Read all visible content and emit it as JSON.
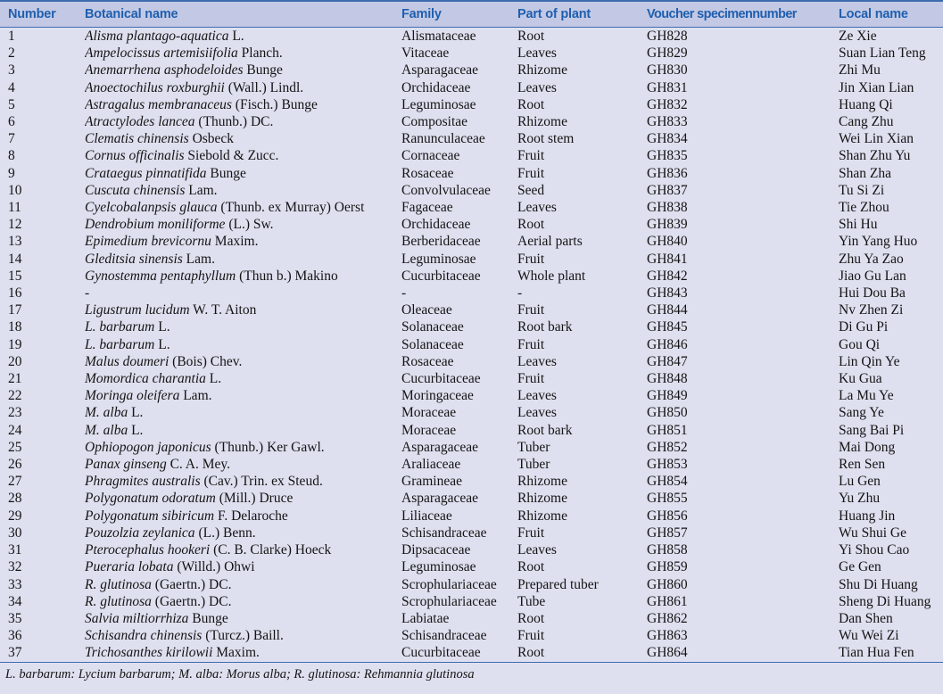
{
  "table": {
    "columns": [
      {
        "key": "number",
        "label": "Number"
      },
      {
        "key": "botanical",
        "label": "Botanical name"
      },
      {
        "key": "family",
        "label": "Family"
      },
      {
        "key": "part",
        "label": "Part of plant"
      },
      {
        "key": "voucher",
        "label": "Voucher specimennumber"
      },
      {
        "key": "local",
        "label": "Local name"
      }
    ],
    "rows": [
      {
        "number": "1",
        "botanical_italic": "Alisma plantago-aquatica",
        "botanical_rest": " L.",
        "family": "Alismataceae",
        "part": "Root",
        "voucher": "GH828",
        "local": "Ze Xie"
      },
      {
        "number": "2",
        "botanical_italic": "Ampelocissus artemisiifolia",
        "botanical_rest": " Planch.",
        "family": "Vitaceae",
        "part": "Leaves",
        "voucher": "GH829",
        "local": "Suan Lian Teng"
      },
      {
        "number": "3",
        "botanical_italic": "Anemarrhena asphodeloides",
        "botanical_rest": " Bunge",
        "family": "Asparagaceae",
        "part": "Rhizome",
        "voucher": "GH830",
        "local": "Zhi Mu"
      },
      {
        "number": "4",
        "botanical_italic": "Anoectochilus roxburghii",
        "botanical_rest": " (Wall.) Lindl.",
        "family": "Orchidaceae",
        "part": "Leaves",
        "voucher": "GH831",
        "local": "Jin Xian Lian"
      },
      {
        "number": "5",
        "botanical_italic": "Astragalus membranaceus",
        "botanical_rest": " (Fisch.) Bunge",
        "family": "Leguminosae",
        "part": "Root",
        "voucher": "GH832",
        "local": "Huang Qi"
      },
      {
        "number": "6",
        "botanical_italic": "Atractylodes lancea",
        "botanical_rest": " (Thunb.) DC.",
        "family": "Compositae",
        "part": "Rhizome",
        "voucher": "GH833",
        "local": "Cang Zhu"
      },
      {
        "number": "7",
        "botanical_italic": "Clematis chinensis",
        "botanical_rest": " Osbeck",
        "family": "Ranunculaceae",
        "part": "Root stem",
        "voucher": "GH834",
        "local": "Wei Lin Xian"
      },
      {
        "number": "8",
        "botanical_italic": "Cornus officinalis",
        "botanical_rest": " Siebold & Zucc.",
        "family": "Cornaceae",
        "part": "Fruit",
        "voucher": "GH835",
        "local": "Shan Zhu Yu"
      },
      {
        "number": "9",
        "botanical_italic": "Crataegus pinnatifida",
        "botanical_rest": " Bunge",
        "family": "Rosaceae",
        "part": "Fruit",
        "voucher": "GH836",
        "local": "Shan Zha"
      },
      {
        "number": "10",
        "botanical_italic": "Cuscuta chinensis",
        "botanical_rest": " Lam.",
        "family": "Convolvulaceae",
        "part": "Seed",
        "voucher": "GH837",
        "local": "Tu Si Zi"
      },
      {
        "number": "11",
        "botanical_italic": "Cyelcobalanpsis glauca",
        "botanical_rest": " (Thunb. ex Murray) Oerst",
        "family": "Fagaceae",
        "part": "Leaves",
        "voucher": "GH838",
        "local": "Tie Zhou"
      },
      {
        "number": "12",
        "botanical_italic": "Dendrobium moniliforme",
        "botanical_rest": " (L.) Sw.",
        "family": "Orchidaceae",
        "part": "Root",
        "voucher": "GH839",
        "local": "Shi Hu"
      },
      {
        "number": "13",
        "botanical_italic": "Epimedium brevicornu",
        "botanical_rest": " Maxim.",
        "family": "Berberidaceae",
        "part": "Aerial parts",
        "voucher": "GH840",
        "local": "Yin Yang Huo"
      },
      {
        "number": "14",
        "botanical_italic": "Gleditsia sinensis",
        "botanical_rest": " Lam.",
        "family": "Leguminosae",
        "part": "Fruit",
        "voucher": "GH841",
        "local": "Zhu Ya Zao"
      },
      {
        "number": "15",
        "botanical_italic": "Gynostemma pentaphyllum",
        "botanical_rest": " (Thun b.) Makino",
        "family": "Cucurbitaceae",
        "part": "Whole plant",
        "voucher": "GH842",
        "local": "Jiao Gu Lan"
      },
      {
        "number": "16",
        "botanical_italic": "",
        "botanical_rest": "-",
        "family": "-",
        "part": "-",
        "voucher": "GH843",
        "local": "Hui Dou Ba"
      },
      {
        "number": "17",
        "botanical_italic": "Ligustrum lucidum",
        "botanical_rest": " W. T. Aiton",
        "family": "Oleaceae",
        "part": "Fruit",
        "voucher": "GH844",
        "local": "Nv Zhen Zi"
      },
      {
        "number": "18",
        "botanical_italic": "L. barbarum",
        "botanical_rest": " L.",
        "family": "Solanaceae",
        "part": "Root bark",
        "voucher": "GH845",
        "local": "Di Gu Pi"
      },
      {
        "number": "19",
        "botanical_italic": "L. barbarum",
        "botanical_rest": " L.",
        "family": "Solanaceae",
        "part": "Fruit",
        "voucher": "GH846",
        "local": "Gou Qi"
      },
      {
        "number": "20",
        "botanical_italic": "Malus doumeri",
        "botanical_rest": " (Bois) Chev.",
        "family": "Rosaceae",
        "part": "Leaves",
        "voucher": "GH847",
        "local": "Lin Qin Ye"
      },
      {
        "number": "21",
        "botanical_italic": "Momordica charantia",
        "botanical_rest": " L.",
        "family": "Cucurbitaceae",
        "part": "Fruit",
        "voucher": "GH848",
        "local": "Ku Gua"
      },
      {
        "number": "22",
        "botanical_italic": "Moringa oleifera",
        "botanical_rest": " Lam.",
        "family": "Moringaceae",
        "part": "Leaves",
        "voucher": "GH849",
        "local": "La Mu Ye"
      },
      {
        "number": "23",
        "botanical_italic": "M. alba",
        "botanical_rest": " L.",
        "family": "Moraceae",
        "part": "Leaves",
        "voucher": "GH850",
        "local": "Sang Ye"
      },
      {
        "number": "24",
        "botanical_italic": "M. alba",
        "botanical_rest": " L.",
        "family": "Moraceae",
        "part": "Root bark",
        "voucher": "GH851",
        "local": "Sang Bai Pi"
      },
      {
        "number": "25",
        "botanical_italic": "Ophiopogon japonicus",
        "botanical_rest": " (Thunb.) Ker Gawl.",
        "family": "Asparagaceae",
        "part": "Tuber",
        "voucher": "GH852",
        "local": "Mai Dong"
      },
      {
        "number": "26",
        "botanical_italic": "Panax ginseng",
        "botanical_rest": " C. A. Mey.",
        "family": "Araliaceae",
        "part": "Tuber",
        "voucher": "GH853",
        "local": "Ren Sen"
      },
      {
        "number": "27",
        "botanical_italic": "Phragmites australis",
        "botanical_rest": " (Cav.) Trin. ex Steud.",
        "family": "Gramineae",
        "part": "Rhizome",
        "voucher": "GH854",
        "local": "Lu Gen"
      },
      {
        "number": "28",
        "botanical_italic": "Polygonatum odoratum",
        "botanical_rest": " (Mill.) Druce",
        "family": "Asparagaceae",
        "part": "Rhizome",
        "voucher": "GH855",
        "local": "Yu Zhu"
      },
      {
        "number": "29",
        "botanical_italic": "Polygonatum sibiricum",
        "botanical_rest": " F. Delaroche",
        "family": "Liliaceae",
        "part": "Rhizome",
        "voucher": "GH856",
        "local": "Huang Jin"
      },
      {
        "number": "30",
        "botanical_italic": "Pouzolzia zeylanica",
        "botanical_rest": " (L.) Benn.",
        "family": "Schisandraceae",
        "part": "Fruit",
        "voucher": "GH857",
        "local": "Wu Shui Ge"
      },
      {
        "number": "31",
        "botanical_italic": "Pterocephalus hookeri",
        "botanical_rest": " (C. B. Clarke) Hoeck",
        "family": "Dipsacaceae",
        "part": "Leaves",
        "voucher": "GH858",
        "local": "Yi Shou Cao"
      },
      {
        "number": "32",
        "botanical_italic": "Pueraria lobata",
        "botanical_rest": " (Willd.) Ohwi",
        "family": "Leguminosae",
        "part": "Root",
        "voucher": "GH859",
        "local": "Ge Gen"
      },
      {
        "number": "33",
        "botanical_italic": "R. glutinosa",
        "botanical_rest": " (Gaertn.) DC.",
        "family": "Scrophulariaceae",
        "part": "Prepared tuber",
        "voucher": "GH860",
        "local": "Shu Di Huang"
      },
      {
        "number": "34",
        "botanical_italic": "R. glutinosa",
        "botanical_rest": " (Gaertn.) DC.",
        "family": "Scrophulariaceae",
        "part": "Tube",
        "voucher": "GH861",
        "local": "Sheng Di Huang"
      },
      {
        "number": "35",
        "botanical_italic": "Salvia miltiorrhiza",
        "botanical_rest": " Bunge",
        "family": "Labiatae",
        "part": "Root",
        "voucher": "GH862",
        "local": "Dan Shen"
      },
      {
        "number": "36",
        "botanical_italic": "Schisandra chinensis",
        "botanical_rest": " (Turcz.) Baill.",
        "family": "Schisandraceae",
        "part": "Fruit",
        "voucher": "GH863",
        "local": "Wu Wei Zi"
      },
      {
        "number": "37",
        "botanical_italic": "Trichosanthes kirilowii",
        "botanical_rest": " Maxim.",
        "family": "Cucurbitaceae",
        "part": "Root",
        "voucher": "GH864",
        "local": "Tian Hua Fen"
      }
    ],
    "footnote": "L. barbarum: Lycium barbarum; M. alba: Morus alba; R. glutinosa: Rehmannia glutinosa"
  },
  "colors": {
    "header_text": "#1f5fb0",
    "header_bg": "#c3c9e4",
    "body_bg": "#dee0ef",
    "rule": "#3d6bb0",
    "body_text": "#141414"
  }
}
